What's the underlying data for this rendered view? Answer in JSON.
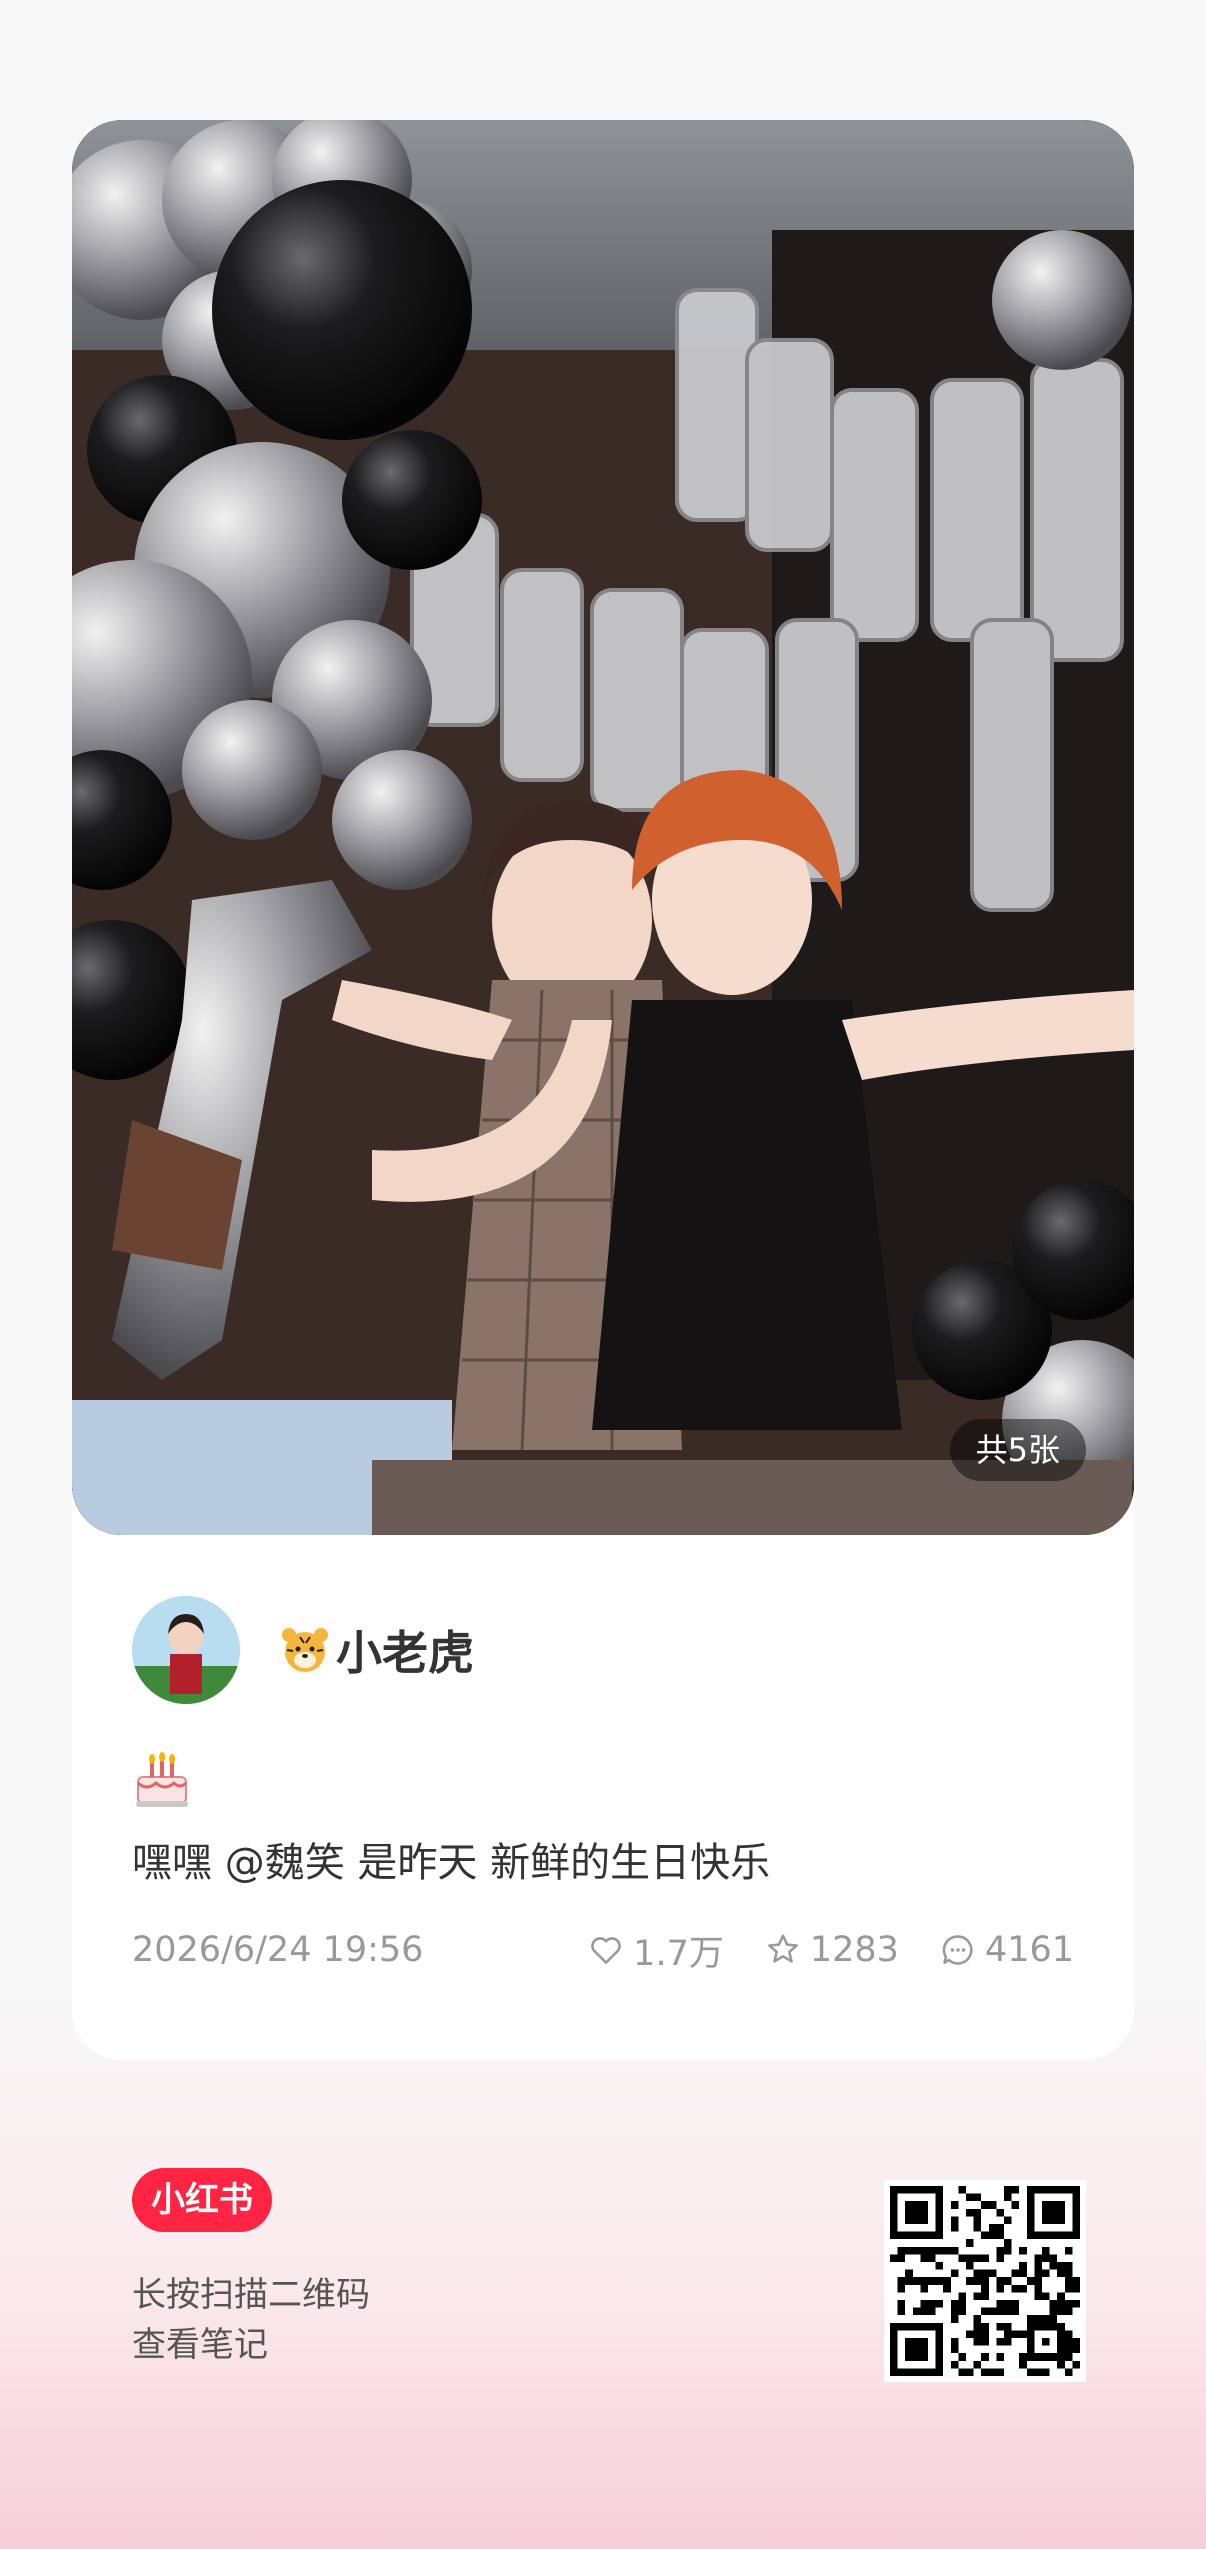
{
  "post": {
    "image_count_label": "共5张",
    "author_name": "小老虎",
    "author_emoji": "tiger-face-icon",
    "caption_emoji": "birthday-cake-icon",
    "caption": "嘿嘿 @魏笑 是昨天 新鲜的生日快乐",
    "timestamp": "2026/6/24 19:56",
    "likes": "1.7万",
    "collects": "1283",
    "comments": "4161"
  },
  "footer": {
    "brand": "小红书",
    "scan_hint_line1": "长按扫描二维码",
    "scan_hint_line2": "查看笔记"
  },
  "colors": {
    "brand": "#ff2442",
    "muted_text": "#999999",
    "main_text": "#333333"
  }
}
